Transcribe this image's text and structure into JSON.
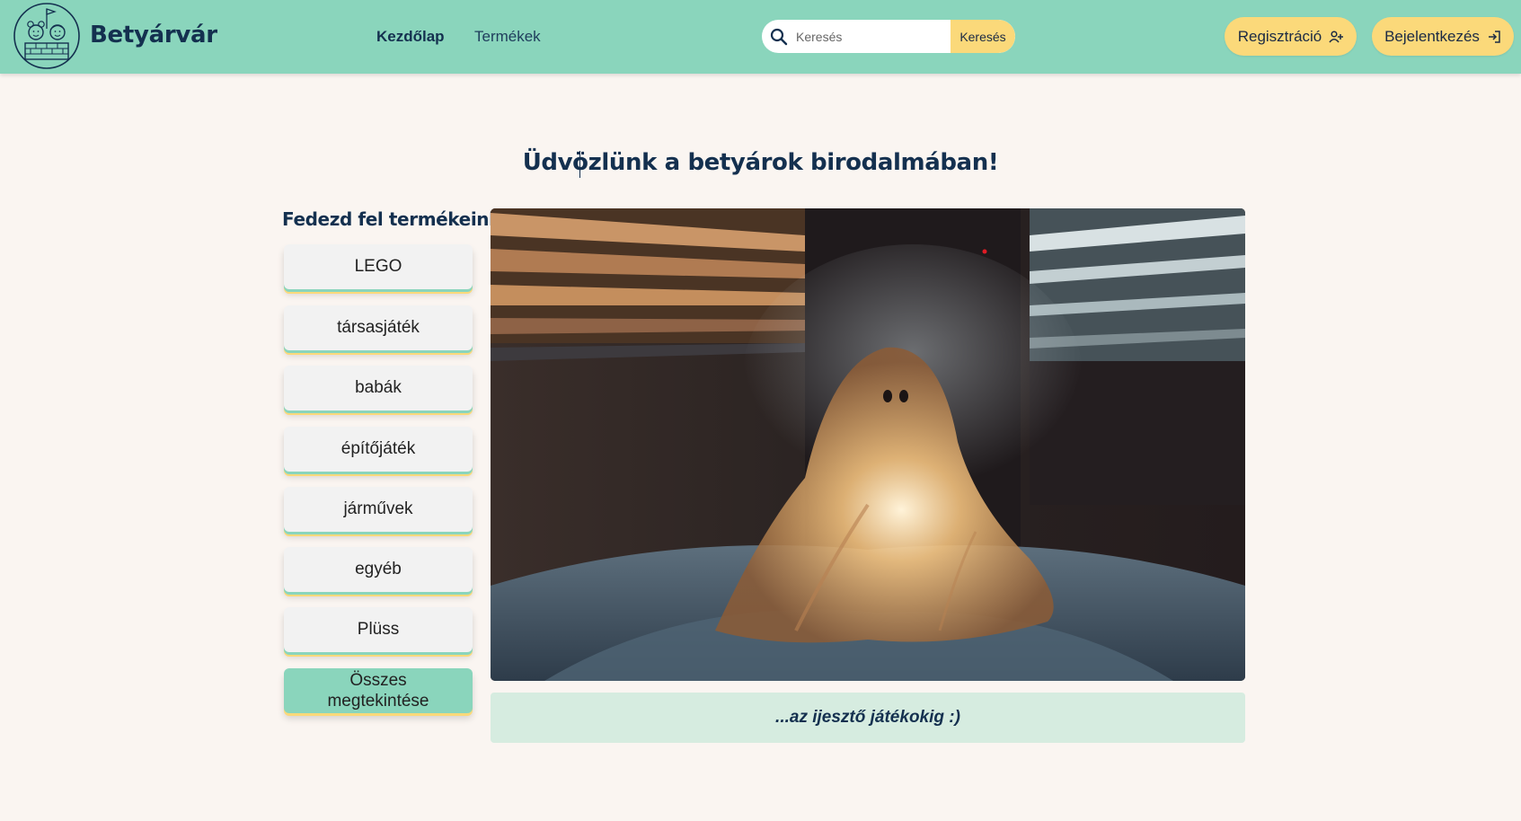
{
  "navbar": {
    "brand": "Betyárvár",
    "links": [
      {
        "label": "Kezdőlap",
        "active": true
      },
      {
        "label": "Termékek",
        "active": false
      }
    ],
    "search": {
      "placeholder": "Keresés",
      "button_label": "Keresés"
    },
    "register_label": "Regisztráció",
    "login_label": "Bejelentkezés",
    "colors": {
      "background": "#8ad5bc",
      "accent": "#fbd97a"
    }
  },
  "main": {
    "welcome_title": "Üdvözlünk a betyárok birodalmában!",
    "sidebar": {
      "title": "Fedezd fel termékeinket",
      "categories": [
        "LEGO",
        "társasjáték",
        "babák",
        "építőjáték",
        "járművek",
        "egyéb",
        "Plüss"
      ],
      "all_line1": "Összes",
      "all_line2": "megtekintése"
    },
    "hero": {
      "icon": "ghost-photo",
      "caption": "...az ijesztő játékokig :)"
    }
  }
}
